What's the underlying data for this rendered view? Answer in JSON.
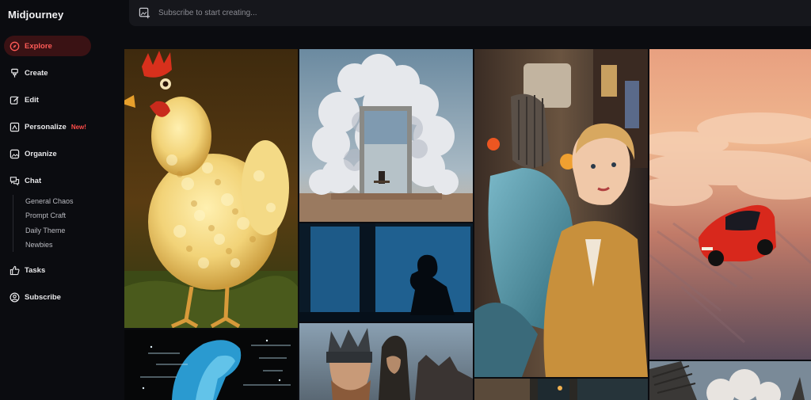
{
  "app": {
    "title": "Midjourney"
  },
  "nav": {
    "items": [
      {
        "label": "Explore",
        "icon": "compass-icon",
        "active": true
      },
      {
        "label": "Create",
        "icon": "brush-icon"
      },
      {
        "label": "Edit",
        "icon": "edit-icon"
      },
      {
        "label": "Personalize",
        "icon": "personalize-icon",
        "badge": "New!"
      },
      {
        "label": "Organize",
        "icon": "image-icon"
      },
      {
        "label": "Chat",
        "icon": "chat-icon"
      },
      {
        "label": "Tasks",
        "icon": "thumbs-up-icon"
      },
      {
        "label": "Subscribe",
        "icon": "user-circle-icon"
      }
    ],
    "chat_rooms": [
      "General Chaos",
      "Prompt Craft",
      "Daily Theme",
      "Newbies"
    ]
  },
  "search": {
    "placeholder": "Subscribe to start creating..."
  },
  "colors": {
    "accent": "#ff4d4a",
    "active_bg": "#3a1214",
    "sidebar_bg": "#0b0c10",
    "topbar_bg": "#16171c"
  },
  "gallery": {
    "images": [
      {
        "subject": "popcorn-chicken"
      },
      {
        "subject": "cloud-tree-door"
      },
      {
        "subject": "robot-woman-selfie"
      },
      {
        "subject": "red-car-over-clouds"
      },
      {
        "subject": "silhouette-man-window"
      },
      {
        "subject": "blue-xray-figure"
      },
      {
        "subject": "viking-warriors"
      },
      {
        "subject": "street-scene"
      },
      {
        "subject": "smoky-landscape"
      }
    ]
  }
}
